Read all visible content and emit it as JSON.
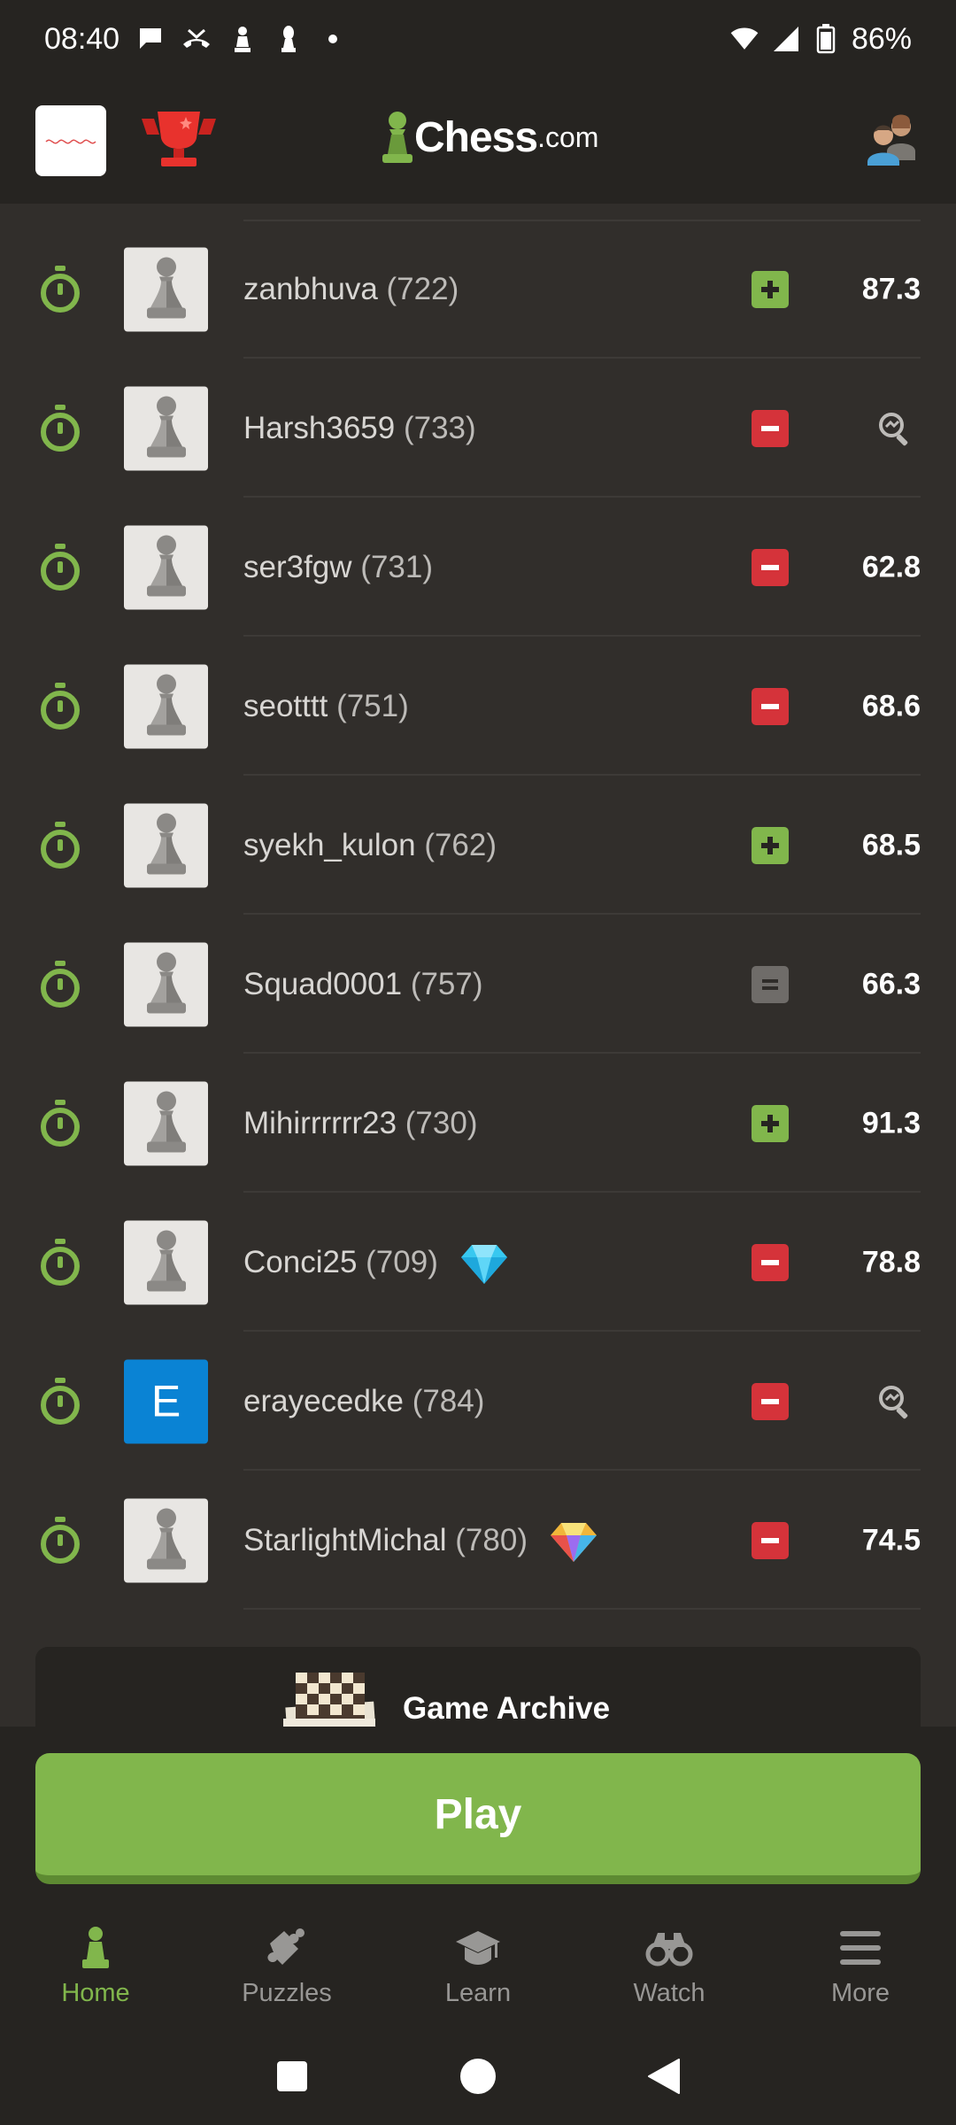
{
  "status_bar": {
    "time": "08:40",
    "battery": "86%"
  },
  "header": {
    "logo_text": "Chess",
    "logo_suffix": ".com"
  },
  "games": [
    {
      "username": "zanbhuva",
      "rating": "(722)",
      "result": "win",
      "accuracy": "87.3",
      "avatar": "pawn",
      "badge": ""
    },
    {
      "username": "Harsh3659",
      "rating": "(733)",
      "result": "loss",
      "accuracy": "",
      "avatar": "pawn",
      "badge": ""
    },
    {
      "username": "ser3fgw",
      "rating": "(731)",
      "result": "loss",
      "accuracy": "62.8",
      "avatar": "pawn",
      "badge": ""
    },
    {
      "username": "seotttt",
      "rating": "(751)",
      "result": "loss",
      "accuracy": "68.6",
      "avatar": "pawn",
      "badge": ""
    },
    {
      "username": "syekh_kulon",
      "rating": "(762)",
      "result": "win",
      "accuracy": "68.5",
      "avatar": "pawn",
      "badge": ""
    },
    {
      "username": "Squad0001",
      "rating": "(757)",
      "result": "draw",
      "accuracy": "66.3",
      "avatar": "pawn",
      "badge": ""
    },
    {
      "username": "Mihirrrrrr23",
      "rating": "(730)",
      "result": "win",
      "accuracy": "91.3",
      "avatar": "pawn",
      "badge": ""
    },
    {
      "username": "Conci25",
      "rating": "(709)",
      "result": "loss",
      "accuracy": "78.8",
      "avatar": "pawn",
      "badge": "diamond-blue"
    },
    {
      "username": "erayecedke",
      "rating": "(784)",
      "result": "loss",
      "accuracy": "",
      "avatar": "E",
      "badge": ""
    },
    {
      "username": "StarlightMichal",
      "rating": "(780)",
      "result": "loss",
      "accuracy": "74.5",
      "avatar": "pawn",
      "badge": "diamond-rainbow"
    }
  ],
  "archive": {
    "label": "Game Archive"
  },
  "play_button": {
    "label": "Play"
  },
  "bottom_nav": [
    {
      "label": "Home",
      "icon": "pawn-icon",
      "active": true
    },
    {
      "label": "Puzzles",
      "icon": "puzzle-icon",
      "active": false
    },
    {
      "label": "Learn",
      "icon": "graduation-cap-icon",
      "active": false
    },
    {
      "label": "Watch",
      "icon": "binoculars-icon",
      "active": false
    },
    {
      "label": "More",
      "icon": "menu-icon",
      "active": false
    }
  ],
  "colors": {
    "win": "#81b64c",
    "loss": "#d5333a",
    "draw": "#6f6c69",
    "accent": "#81b64c"
  }
}
